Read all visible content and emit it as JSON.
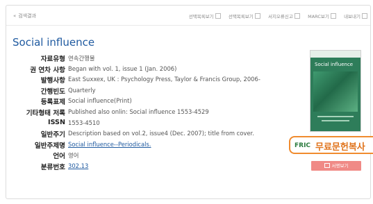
{
  "topbar": {
    "back_label": "검색결과",
    "tools": [
      {
        "label": "선택목록보기",
        "icon": "list-icon"
      },
      {
        "label": "선택목록보기",
        "icon": "list-icon"
      },
      {
        "label": "서지오류신고",
        "icon": "report-icon"
      },
      {
        "label": "MARC보기",
        "icon": "marc-icon"
      },
      {
        "label": "내보내기",
        "icon": "export-icon"
      }
    ]
  },
  "record": {
    "title": "Social influence",
    "fields": [
      {
        "label": "자료유형",
        "value": "연속간행물",
        "link": false
      },
      {
        "label": "권 연차 사항",
        "value": "Began with vol. 1, issue 1 (Jan. 2006)",
        "link": false
      },
      {
        "label": "발행사항",
        "value": "East Suxxex, UK : Psychology Press, Taylor & Francis Group, 2006-",
        "link": false
      },
      {
        "label": "간행빈도",
        "value": "Quarterly",
        "link": false
      },
      {
        "label": "등록표제",
        "value": "Social influence(Print)",
        "link": false
      },
      {
        "label": "기타형태 저록",
        "value": "Published also onlin: Social influence 1553-4529",
        "link": false
      },
      {
        "label": "ISSN",
        "value": "1553-4510",
        "link": false
      },
      {
        "label": "일반주기",
        "value": "Description based on vol.2, issue4 (Dec. 2007); title from cover.",
        "link": false
      },
      {
        "label": "일반주제명",
        "value": "Social influence--Periodicals.",
        "link": true
      },
      {
        "label": "언어",
        "value": "영어",
        "link": false
      },
      {
        "label": "분류번호",
        "value": "302.13",
        "link": true
      }
    ]
  },
  "cover": {
    "title": "Social influence"
  },
  "badge": {
    "logo": "FRIC",
    "text": "무료문헌복사"
  },
  "view_button": {
    "label": "서평보기"
  },
  "colors": {
    "title": "#1f5aa0",
    "badge_border": "#f08b2e",
    "badge_text": "#e0731b",
    "view_button": "#f08a86",
    "cover": "#2e7d5a"
  }
}
